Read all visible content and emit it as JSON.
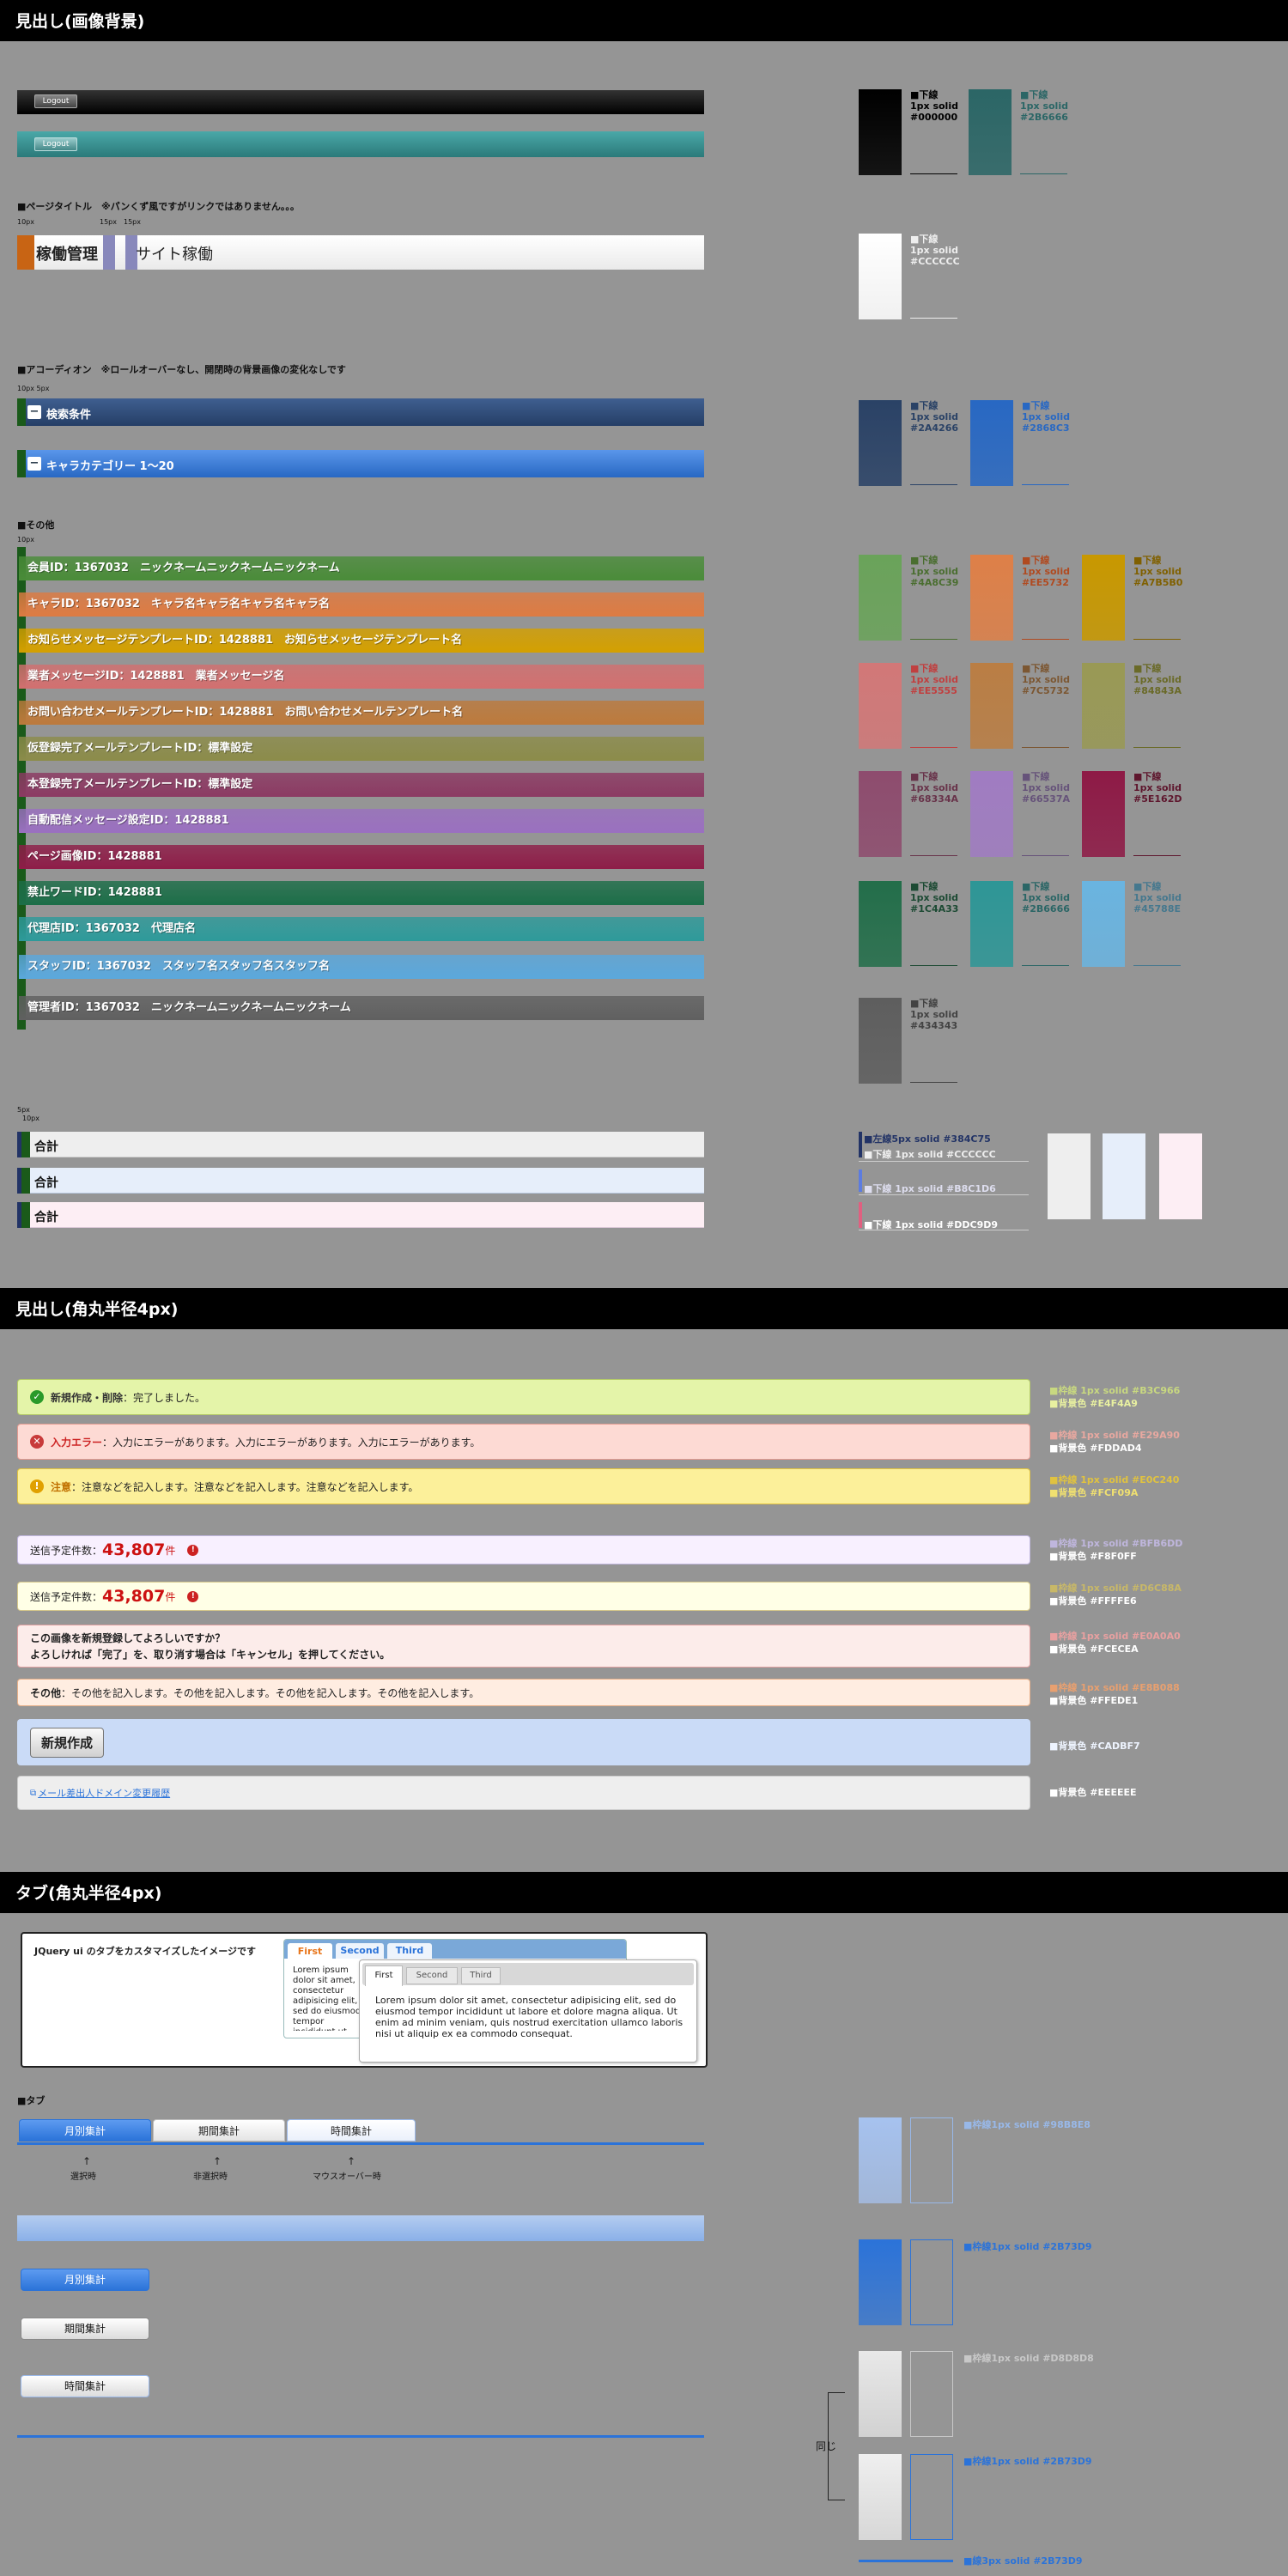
{
  "section1": {
    "title": "見出し(画像背景)",
    "logout": "Logout",
    "page_title_label": "■ページタイトル　※パンくず風ですがリンクではありません。。。",
    "dims": {
      "d1": "10px",
      "d2": "15px",
      "d3": "15px",
      "d4": "10px  5px",
      "d5": "10px",
      "d6": "5px",
      "d7": "10px"
    },
    "breadcrumb": {
      "first": "稼働管理",
      "second": "サイト稼働"
    },
    "accordion_label": "■アコーディオン　※ロールオーバーなし、開閉時の背景画像の変化なしです",
    "accordion": [
      {
        "icon": "−",
        "text": "検索条件"
      },
      {
        "icon": "−",
        "text": "キャラカテゴリー 1～20"
      }
    ],
    "other_label": "■その他",
    "rows": [
      {
        "text": "会員ID：1367032　ニックネームニックネームニックネーム",
        "color": "#4A8C39"
      },
      {
        "text": "キャラID：1367032　キャラ名キャラ名キャラ名キャラ名",
        "color": "#DE7B42"
      },
      {
        "text": "お知らせメッセージテンプレートID：1428881　お知らせメッセージテンプレート名",
        "color": "#D4A000"
      },
      {
        "text": "業者メッセージID：1428881　業者メッセージ名",
        "color": "#D27070"
      },
      {
        "text": "お問い合わせメールテンプレートID：1428881　お問い合わせメールテンプレート名",
        "color": "#BD7A3C"
      },
      {
        "text": "仮登録完了メールテンプレートID：標準設定",
        "color": "#8C8C4A"
      },
      {
        "text": "本登録完了メールテンプレートID：標準設定",
        "color": "#8C3A63"
      },
      {
        "text": "自動配信メッセージ設定ID：1428881",
        "color": "#9A70C0"
      },
      {
        "text": "ページ画像ID：1428881",
        "color": "#8E1D48"
      },
      {
        "text": "禁止ワードID：1428881",
        "color": "#1C6E48"
      },
      {
        "text": "代理店ID：1367032　代理店名",
        "color": "#2E9A9A"
      },
      {
        "text": "スタッフID：1367032　スタッフ名スタッフ名スタッフ名",
        "color": "#5BA8DC"
      },
      {
        "text": "管理者ID：1367032　ニックネームニックネームニックネーム",
        "color": "#606060"
      }
    ],
    "totals": [
      {
        "text": "合計",
        "bg": "#EEEEEE",
        "border": "#CCCCCC"
      },
      {
        "text": "合計",
        "bg": "#E6EEFA",
        "border": "#B8C8DE"
      },
      {
        "text": "合計",
        "bg": "#FDEEF4",
        "border": "#DDC9D9"
      }
    ],
    "swatches": {
      "header": [
        {
          "color": "#000000",
          "text": "■下線\n1px solid\n#000000",
          "tc": "#000000"
        },
        {
          "color": "#2B6666",
          "text": "■下線\n1px solid\n#2B6666",
          "tc": "#2B6666"
        },
        {
          "color": "#FFFFFF",
          "text": "■下線\n1px solid\n#CCCCCC",
          "tc": "#EEEEEE"
        },
        {
          "color": "#2A4266",
          "text": "■下線\n1px solid\n#2A4266",
          "tc": "#2A4266"
        },
        {
          "color": "#2868C3",
          "text": "■下線\n1px solid\n#2868C3",
          "tc": "#2868C3"
        }
      ],
      "other": [
        {
          "color": "#6AA35A",
          "text": "■下線\n1px solid\n#4A8C39",
          "tc": "#4A6E30"
        },
        {
          "color": "#DE8048",
          "text": "■下線\n1px solid\n#EE5732",
          "tc": "#B04A20"
        },
        {
          "color": "#C89800",
          "text": "■下線\n1px solid\n#A7B5B0",
          "tc": "#806000"
        },
        {
          "color": "#D27878",
          "text": "■下線\n1px solid\n#EE5555",
          "tc": "#C04040"
        },
        {
          "color": "#BA7E44",
          "text": "■下線\n1px solid\n#7C5732",
          "tc": "#7C5732"
        },
        {
          "color": "#999955",
          "text": "■下線\n1px solid\n#84843A",
          "tc": "#6A6A28"
        },
        {
          "color": "#8E4C6E",
          "text": "■下線\n1px solid\n#68334A",
          "tc": "#68334A"
        },
        {
          "color": "#A07CC2",
          "text": "■下線\n1px solid\n#66537A",
          "tc": "#66537A"
        },
        {
          "color": "#8E1A46",
          "text": "■下線\n1px solid\n#5E162D",
          "tc": "#5E162D"
        },
        {
          "color": "#236E4A",
          "text": "■下線\n1px solid\n#1C4A33",
          "tc": "#1C4A33"
        },
        {
          "color": "#2E9696",
          "text": "■下線\n1px solid\n#2B6666",
          "tc": "#2B6666"
        },
        {
          "color": "#6AB4E0",
          "text": "■下線\n1px solid\n#45788E",
          "tc": "#45788E"
        },
        {
          "color": "#5E5E5E",
          "text": "■下線\n1px solid\n#434343",
          "tc": "#434343"
        }
      ],
      "totals_legend": [
        {
          "text": "■左線5px solid #384C75",
          "color": "#223366"
        },
        {
          "text": "■下線 1px solid #CCCCCC",
          "color": "#EEEEEE"
        },
        {
          "text": "■下線 1px solid #B8C1D6",
          "color": "#DDDDEE"
        },
        {
          "text": "■下線 1px solid #DDC9D9",
          "color": "#FFFFFF"
        }
      ]
    }
  },
  "section2": {
    "title": "見出し(角丸半径4px)",
    "notices": [
      {
        "strong": "新規作成・削除",
        "text": "：完了しました。",
        "icon": "✓",
        "icon_color": "#2A9A2A",
        "bg": "#E4F4A9",
        "border": "#B3C966",
        "strong_color": "#333333"
      },
      {
        "strong": "入力エラー",
        "text": "：入力にエラーがあります。入力にエラーがあります。入力にエラーがあります。",
        "icon": "✕",
        "icon_color": "#C83A3A",
        "bg": "#FDDAD4",
        "border": "#E29A90",
        "strong_color": "#CC2222"
      },
      {
        "strong": "注意",
        "text": "：注意などを記入します。注意などを記入します。注意などを記入します。",
        "icon": "!",
        "icon_color": "#E0A000",
        "bg": "#FCF09A",
        "border": "#E0C240",
        "strong_color": "#C07000"
      }
    ],
    "scheduled": [
      {
        "label": "送信予定件数：",
        "num": "43,807",
        "unit": "件",
        "bg": "#F8F0FF",
        "border": "#BFB6DD"
      },
      {
        "label": "送信予定件数：",
        "num": "43,807",
        "unit": "件",
        "bg": "#FFFFE6",
        "border": "#D6C88A"
      }
    ],
    "confirm": {
      "line1": "この画像を新規登録してよろしいですか？",
      "line2": "よろしければ「完了」を、取り消す場合は「キャンセル」を押してください。"
    },
    "other": {
      "strong": "その他",
      "text": "：その他を記入します。その他を記入します。その他を記入します。その他を記入します。"
    },
    "new_button": "新規作成",
    "link": "メール差出人ドメイン変更履歴",
    "legends": [
      {
        "a": "■枠線 1px solid #B3C966",
        "b": "■背景色 #E4F4A9",
        "ca": "#C8D880",
        "cb": "#E8F0A0"
      },
      {
        "a": "■枠線 1px solid #E29A90",
        "b": "■背景色 #FDDAD4",
        "ca": "#E8A8A0",
        "cb": "#FFFFFF"
      },
      {
        "a": "■枠線 1px solid #E0C240",
        "b": "■背景色 #FCF09A",
        "ca": "#E0C240",
        "cb": "#F0E070"
      },
      {
        "a": "■枠線 1px solid #BFB6DD",
        "b": "■背景色 #F8F0FF",
        "ca": "#BFB6DD",
        "cb": "#FFFFFF"
      },
      {
        "a": "■枠線 1px solid #D6C88A",
        "b": "■背景色 #FFFFE6",
        "ca": "#C8B868",
        "cb": "#FFFFFF"
      },
      {
        "a": "■枠線 1px solid #E0A0A0",
        "b": "■背景色 #FCECEA",
        "ca": "#E8A0A0",
        "cb": "#FFFFFF"
      },
      {
        "a": "■枠線 1px solid #E8B088",
        "b": "■背景色 #FFEDE1",
        "ca": "#E8A070",
        "cb": "#FFFFFF"
      },
      {
        "a": "",
        "b": "■背景色 #CADBF7",
        "ca": "#CADBF7",
        "cb": "#EEF4FF"
      },
      {
        "a": "",
        "b": "■背景色 #EEEEEE",
        "ca": "#EEEEEE",
        "cb": "#FFFFFF"
      }
    ]
  },
  "section3": {
    "title": "タブ(角丸半径4px)",
    "jq_caption": "JQuery ui のタブをカスタマイズしたイメージです",
    "jq_tabs": [
      "First",
      "Second",
      "Third"
    ],
    "jq_lorem_back": "Lorem ipsum dolor sit amet, consectetur adipisicing elit, sed do eiusmod tempor incididunt ut labore et dolore magna aliqua. Ut enim ad minim veniam, quis nostrud exercitation ullamco laboris nisi ut aliquip",
    "jq_lorem": "Lorem ipsum dolor sit amet, consectetur adipisicing elit, sed do eiusmod tempor incididunt ut labore et dolore magna aliqua. Ut enim ad minim veniam, quis nostrud exercitation ullamco laboris nisi ut aliquip ex ea commodo consequat.",
    "tab_label": "■タブ",
    "tabs": [
      "月別集計",
      "期間集計",
      "時間集計"
    ],
    "states": [
      "選択時",
      "非選択時",
      "マウスオーバー時"
    ],
    "buttons": [
      "月別集計",
      "期間集計",
      "時間集計"
    ],
    "same": "同じ",
    "legends": [
      {
        "text": "■枠線1px solid #98B8E8",
        "color": "#98B8E8"
      },
      {
        "text": "■枠線1px solid #2B73D9",
        "color": "#2B73D9"
      },
      {
        "text": "■枠線1px solid #D8D8D8",
        "color": "#C8C8C8"
      },
      {
        "text": "■枠線1px solid #2B73D9",
        "color": "#2B73D9"
      },
      {
        "text": "■線3px solid #2B73D9",
        "color": "#2B73D9"
      }
    ]
  }
}
